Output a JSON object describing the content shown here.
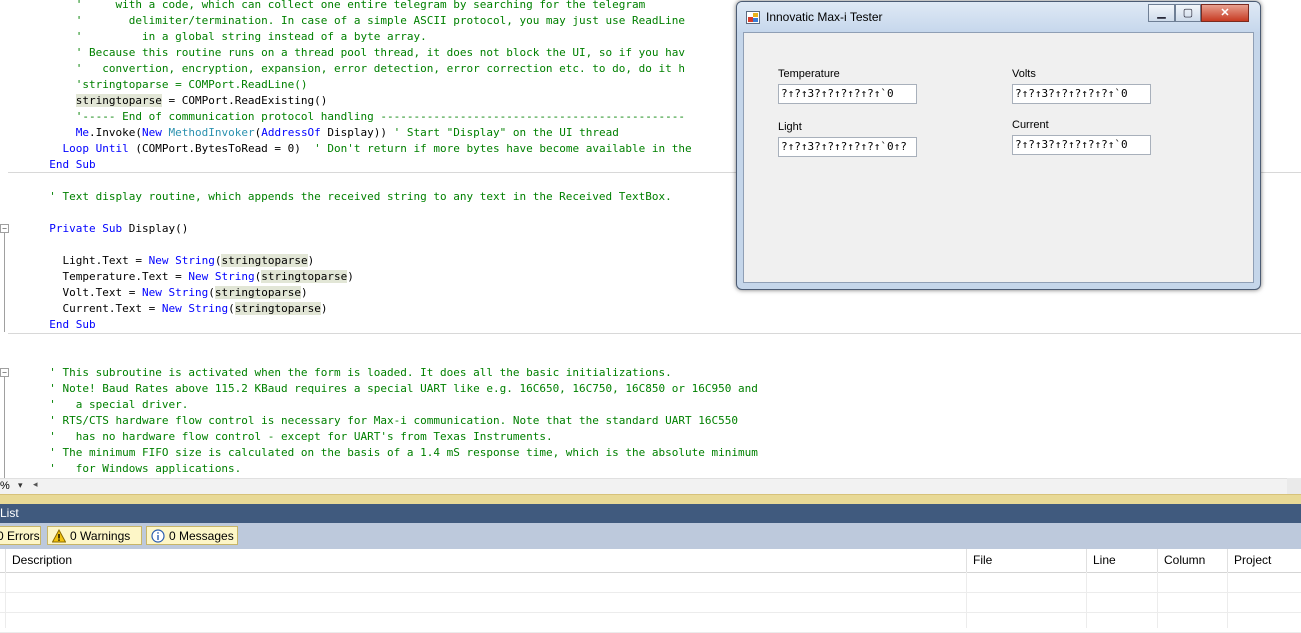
{
  "editor": {
    "lines": [
      [
        {
          "t": "      '     with a code, which can collect one entire telegram by searching for the telegram",
          "c": "cm"
        }
      ],
      [
        {
          "t": "      '       delimiter/termination. In case of a simple ASCII protocol, you may just use ReadLine",
          "c": "cm"
        }
      ],
      [
        {
          "t": "      '         in a global string instead of a byte array.",
          "c": "cm"
        }
      ],
      [
        {
          "t": "      ' Because this routine runs on a thread pool thread, it does not block the UI, so if you hav",
          "c": "cm"
        }
      ],
      [
        {
          "t": "      '   convertion, encryption, expansion, error detection, error correction etc. to do, do it h",
          "c": "cm"
        }
      ],
      [
        {
          "t": "      'stringtoparse = COMPort.ReadLine()",
          "c": "cm"
        }
      ],
      [
        {
          "t": "      "
        },
        {
          "t": "stringtoparse",
          "c": "hl"
        },
        {
          "t": " = COMPort.ReadExisting()"
        }
      ],
      [
        {
          "t": "      '----- End of communication protocol handling ----------------------------------------------",
          "c": "cm"
        }
      ],
      [
        {
          "t": "      "
        },
        {
          "t": "Me",
          "c": "kw"
        },
        {
          "t": ".Invoke("
        },
        {
          "t": "New",
          "c": "kw"
        },
        {
          "t": " "
        },
        {
          "t": "MethodInvoker",
          "c": "ty"
        },
        {
          "t": "("
        },
        {
          "t": "AddressOf",
          "c": "kw"
        },
        {
          "t": " Display)) "
        },
        {
          "t": "' Start \"Display\" on the UI thread",
          "c": "cm"
        }
      ],
      [
        {
          "t": "    "
        },
        {
          "t": "Loop Until",
          "c": "kw"
        },
        {
          "t": " (COMPort.BytesToRead = 0)  "
        },
        {
          "t": "' Don't return if more bytes have become available in the",
          "c": "cm"
        }
      ],
      [
        {
          "t": "  "
        },
        {
          "t": "End Sub",
          "c": "kw"
        }
      ],
      [
        {
          "t": ""
        }
      ],
      [
        {
          "t": "  "
        },
        {
          "t": "' Text display routine, which appends the received string to any text in the Received TextBox.",
          "c": "cm"
        }
      ],
      [
        {
          "t": ""
        }
      ],
      [
        {
          "t": "  "
        },
        {
          "t": "Private Sub",
          "c": "kw"
        },
        {
          "t": " Display()"
        }
      ],
      [
        {
          "t": ""
        }
      ],
      [
        {
          "t": "    Light.Text = "
        },
        {
          "t": "New",
          "c": "kw"
        },
        {
          "t": " "
        },
        {
          "t": "String",
          "c": "kw"
        },
        {
          "t": "("
        },
        {
          "t": "stringtoparse",
          "c": "hl"
        },
        {
          "t": ")"
        }
      ],
      [
        {
          "t": "    Temperature.Text = "
        },
        {
          "t": "New",
          "c": "kw"
        },
        {
          "t": " "
        },
        {
          "t": "String",
          "c": "kw"
        },
        {
          "t": "("
        },
        {
          "t": "stringtoparse",
          "c": "hl"
        },
        {
          "t": ")"
        }
      ],
      [
        {
          "t": "    Volt.Text = "
        },
        {
          "t": "New",
          "c": "kw"
        },
        {
          "t": " "
        },
        {
          "t": "String",
          "c": "kw"
        },
        {
          "t": "("
        },
        {
          "t": "stringtoparse",
          "c": "hl"
        },
        {
          "t": ")"
        }
      ],
      [
        {
          "t": "    Current.Text = "
        },
        {
          "t": "New",
          "c": "kw"
        },
        {
          "t": " "
        },
        {
          "t": "String",
          "c": "kw"
        },
        {
          "t": "("
        },
        {
          "t": "stringtoparse",
          "c": "hl"
        },
        {
          "t": ")"
        }
      ],
      [
        {
          "t": "  "
        },
        {
          "t": "End Sub",
          "c": "kw"
        }
      ],
      [
        {
          "t": ""
        }
      ],
      [
        {
          "t": ""
        }
      ],
      [
        {
          "t": "  "
        },
        {
          "t": "' This subroutine is activated when the form is loaded. It does all the basic initializations.",
          "c": "cm"
        }
      ],
      [
        {
          "t": "  "
        },
        {
          "t": "' Note! Baud Rates above 115.2 KBaud requires a special UART like e.g. 16C650, 16C750, 16C850 or 16C950 and",
          "c": "cm"
        }
      ],
      [
        {
          "t": "  "
        },
        {
          "t": "'   a special driver.",
          "c": "cm"
        }
      ],
      [
        {
          "t": "  "
        },
        {
          "t": "' RTS/CTS hardware flow control is necessary for Max-i communication. Note that the standard UART 16C550",
          "c": "cm"
        }
      ],
      [
        {
          "t": "  "
        },
        {
          "t": "'   has no hardware flow control - except for UART's from Texas Instruments.",
          "c": "cm"
        }
      ],
      [
        {
          "t": "  "
        },
        {
          "t": "' The minimum FIFO size is calculated on the basis of a 1.4 mS response time, which is the absolute minimum",
          "c": "cm"
        }
      ],
      [
        {
          "t": "  "
        },
        {
          "t": "'   for Windows applications.",
          "c": "cm"
        }
      ]
    ],
    "zoom_label": "%",
    "zoom_arrow": "▾",
    "hscroll_left_arrow": "◂"
  },
  "error_list": {
    "title": "List",
    "errors_label": "0 Errors",
    "warnings_label": "0 Warnings",
    "messages_label": "0 Messages",
    "columns": [
      "Description",
      "File",
      "Line",
      "Column",
      "Project"
    ]
  },
  "dialog": {
    "title": "Innovatic Max-i Tester",
    "minimize_glyph": "▁",
    "maximize_glyph": "▢",
    "close_glyph": "✕",
    "fields": {
      "temperature": {
        "label": "Temperature",
        "value": "?↑?↑3?↑?↑?↑?↑?↑`0"
      },
      "volts": {
        "label": "Volts",
        "value": "?↑?↑3?↑?↑?↑?↑?↑`0"
      },
      "light": {
        "label": "Light",
        "value": "?↑?↑3?↑?↑?↑?↑?↑`0↑?"
      },
      "current": {
        "label": "Current",
        "value": "?↑?↑3?↑?↑?↑?↑?↑`0"
      }
    }
  },
  "colors": {
    "comment": "#008000",
    "keyword": "#0000ff",
    "type": "#2b91af",
    "identifier_highlight": "#e2e6d6",
    "error_list_title_bg": "#405a7e",
    "error_list_toolbar_bg": "#bdc9dc",
    "filter_button_bg": "#fdf6c7"
  },
  "icons": {
    "errors": "error-icon",
    "warnings": "warning-icon",
    "messages": "info-icon",
    "dialog_app": "app-icon"
  }
}
